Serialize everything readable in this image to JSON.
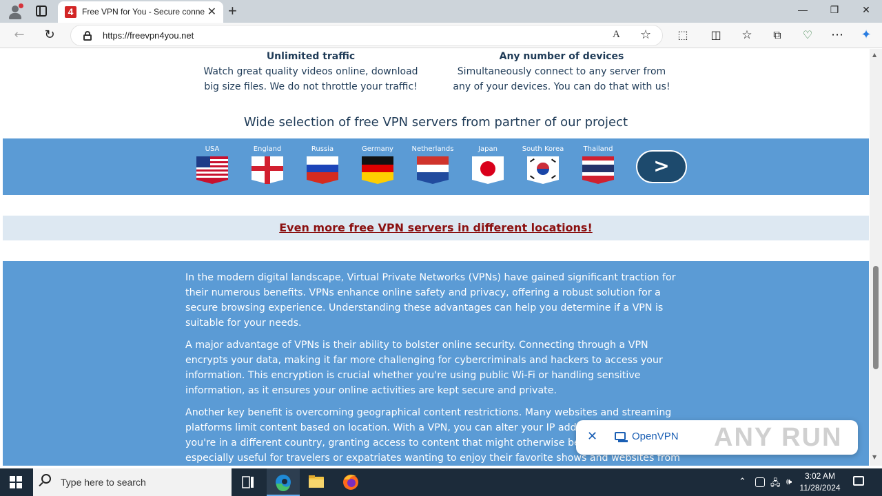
{
  "browser": {
    "tab_title": "Free VPN for You - Secure connection",
    "tab_favicon": "4",
    "url": "https://freevpn4you.net",
    "icons": {
      "back": "←",
      "refresh": "↻",
      "read_aloud": "A",
      "favorite": "☆",
      "extensions": "⬚",
      "split": "◫",
      "favorites": "☆",
      "collections": "⧉",
      "performance": "♡",
      "more": "⋯",
      "copilot": "✦"
    },
    "window": {
      "minimize": "—",
      "maximize": "❐",
      "close": "✕",
      "new_tab": "+",
      "tab_close": "✕"
    }
  },
  "page": {
    "features": [
      {
        "title": "Unlimited traffic",
        "lines": [
          "Watch great quality videos online, download",
          "big size files. We do not throttle your traffic!"
        ]
      },
      {
        "title": "Any number of devices",
        "lines": [
          "Simultaneously connect to any server from",
          "any of your devices. You can do that with us!"
        ]
      }
    ],
    "servers_title": "Wide selection of free VPN servers from partner of our project",
    "countries": [
      "USA",
      "England",
      "Russia",
      "Germany",
      "Netherlands",
      "Japan",
      "South Korea",
      "Thailand"
    ],
    "next_label": ">",
    "more_link": "Even more free VPN servers in different locations!",
    "paragraphs": [
      "In the modern digital landscape, Virtual Private Networks (VPNs) have gained significant traction for their numerous benefits. VPNs enhance online safety and privacy, offering a robust solution for a secure browsing experience. Understanding these advantages can help you determine if a VPN is suitable for your needs.",
      "A major advantage of VPNs is their ability to bolster online security. Connecting through a VPN encrypts your data, making it far more challenging for cybercriminals and hackers to access your information. This encryption is crucial whether you're using public Wi-Fi or handling sensitive information, as it ensures your online activities are kept secure and private.",
      "Another key benefit is overcoming geographical content restrictions. Many websites and streaming platforms limit content based on location. With a VPN, you can alter your IP address to appear as if you're in a different country, granting access to content that might otherwise be unavailable. This is especially useful for travelers or expatriates wanting to enjoy their favorite shows and websites from"
    ],
    "colors": {
      "band": "#5b9bd5",
      "heading": "#1f3b57",
      "link": "#8b1010",
      "button": "#1d4a6d"
    }
  },
  "popup": {
    "close": "✕",
    "label": "OpenVPN",
    "watermark": "ANY RUN"
  },
  "taskbar": {
    "search_placeholder": "Type here to search",
    "time": "3:02 AM",
    "date": "11/28/2024",
    "tray_icons": {
      "chevron": "⌃",
      "network": "🖧",
      "volume": "🕪"
    }
  }
}
